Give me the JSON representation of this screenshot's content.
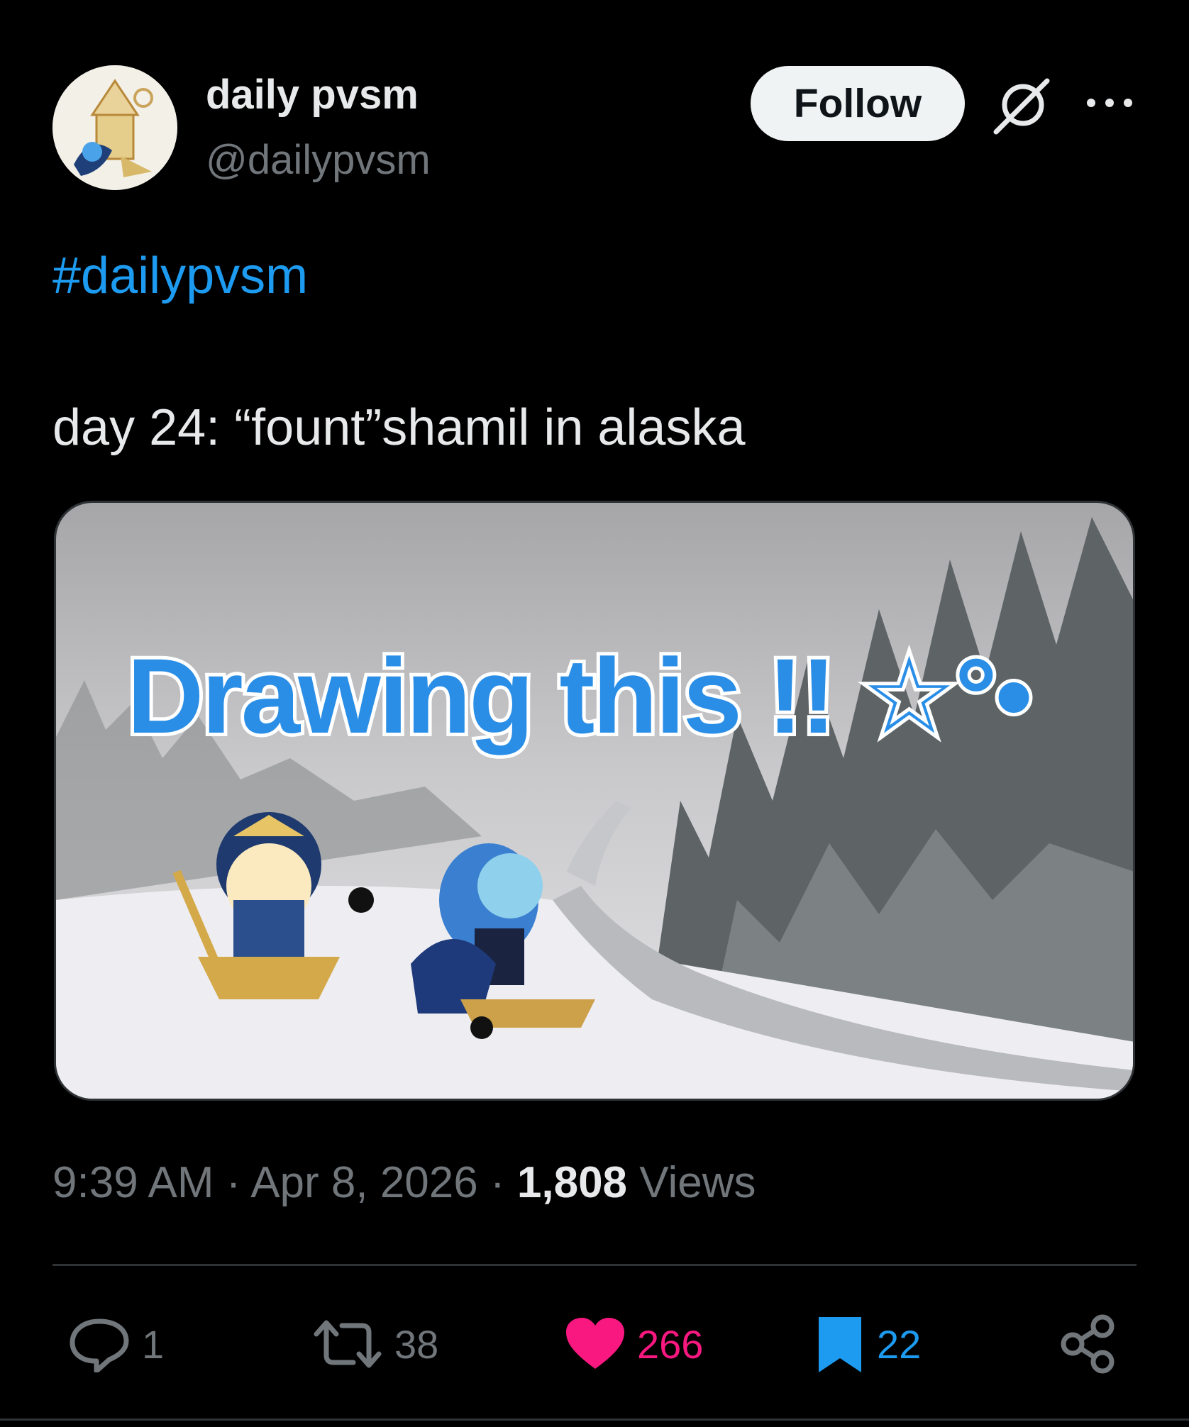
{
  "author": {
    "display_name": "daily pvsm",
    "handle": "@dailypvsm",
    "avatar_icon": "avatar-cookie-character-icon"
  },
  "header": {
    "follow_label": "Follow",
    "grok_icon": "grok-slash-icon",
    "more_icon": "more-dots-icon"
  },
  "tweet": {
    "hashtag": "#dailypvsm",
    "text": "day 24: “fount”shamil in alaska"
  },
  "media": {
    "overlay_text": "Drawing this !! ☆°•",
    "scene": "snowy road through pine forest with two chibi characters",
    "overlay_color": "#2a8ee6"
  },
  "meta": {
    "time": "9:39 AM",
    "separator": "·",
    "date": "Apr 8, 2026",
    "views_count": "1,808",
    "views_label": "Views"
  },
  "actions": {
    "reply": {
      "icon": "reply-bubble-icon",
      "count": "1",
      "color": "#71767b"
    },
    "retweet": {
      "icon": "retweet-icon",
      "count": "38",
      "color": "#71767b"
    },
    "like": {
      "icon": "heart-icon",
      "count": "266",
      "color": "#f91880"
    },
    "bookmark": {
      "icon": "bookmark-icon",
      "count": "22",
      "color": "#1d9bf0"
    },
    "share": {
      "icon": "share-icon"
    }
  }
}
